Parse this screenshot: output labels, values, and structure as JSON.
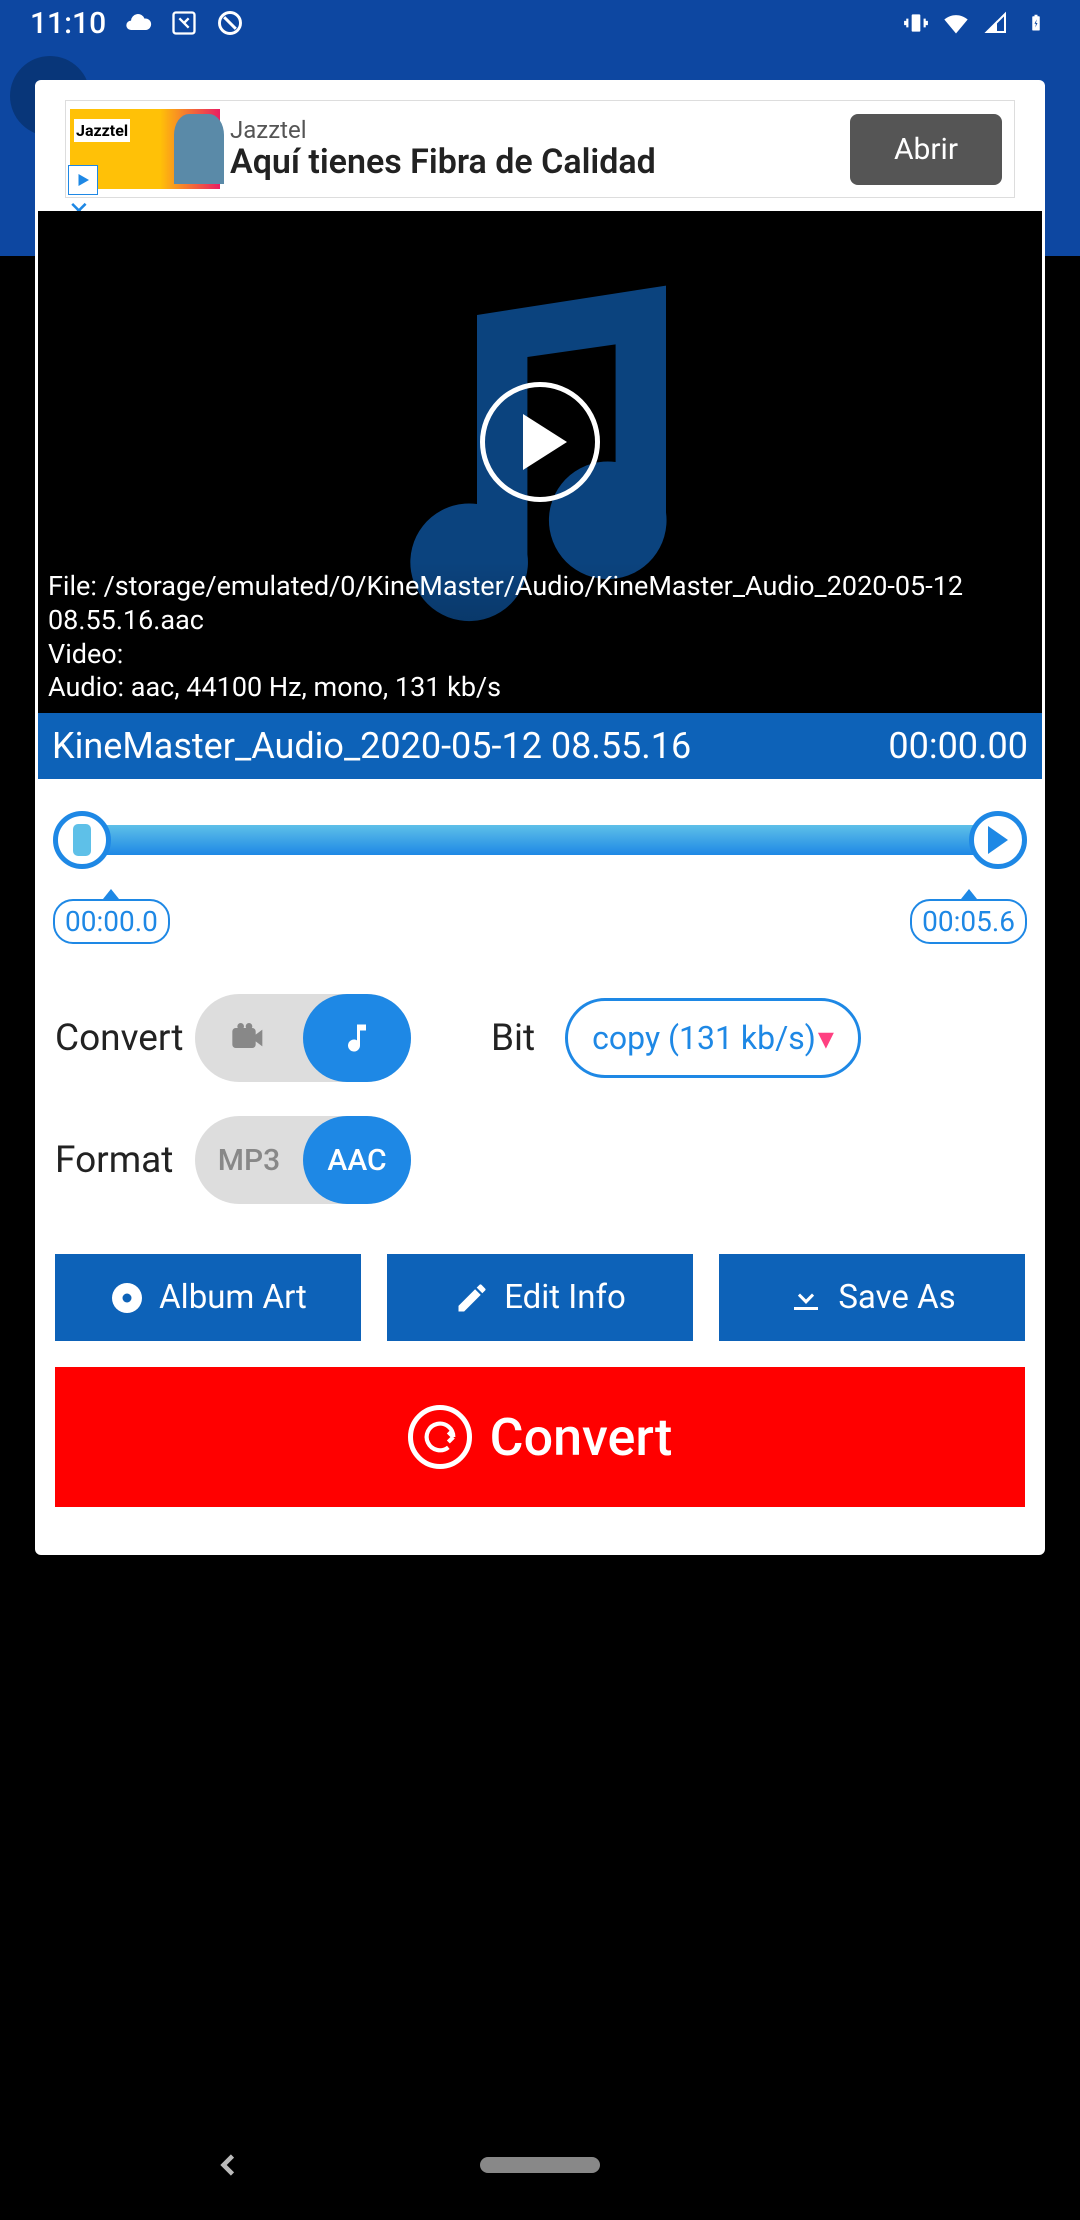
{
  "status": {
    "time": "11:10"
  },
  "ad": {
    "brand": "Jazztel",
    "title_small": "Jazztel",
    "body": "Aquí tienes Fibra de Calidad",
    "cta": "Abrir"
  },
  "preview": {
    "file_line": "File: /storage/emulated/0/KineMaster/Audio/KineMaster_Audio_2020-05-12 08.55.16.aac",
    "video_line": "Video:",
    "audio_line": "Audio: aac,  44100 Hz,  mono, 131 kb/s"
  },
  "titlebar": {
    "name": "KineMaster_Audio_2020-05-12 08.55.16",
    "time": "00:00.00"
  },
  "slider": {
    "start": "00:00.0",
    "end": "00:05.6"
  },
  "options": {
    "convert_label": "Convert",
    "bit_label": "Bit",
    "bit_value": "copy (131 kb/s)",
    "format_label": "Format",
    "format_left": "MP3",
    "format_right": "AAC"
  },
  "actions": {
    "album_art": "Album Art",
    "edit_info": "Edit Info",
    "save_as": "Save As"
  },
  "convert_button": "Convert"
}
